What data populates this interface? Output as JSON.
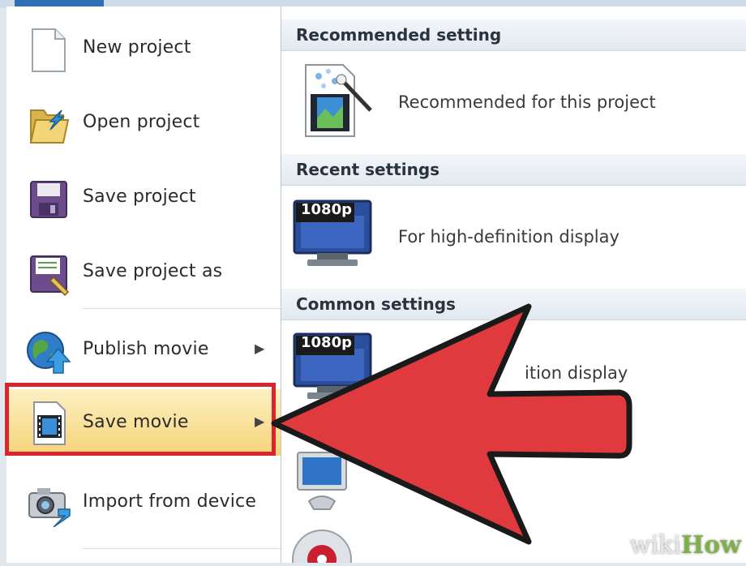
{
  "menu": {
    "items": [
      {
        "label": "New project"
      },
      {
        "label": "Open project"
      },
      {
        "label": "Save project"
      },
      {
        "label": "Save project as"
      },
      {
        "label": "Publish movie",
        "submenu": true
      },
      {
        "label": "Save movie",
        "submenu": true,
        "selected": true
      },
      {
        "label": "Import from device"
      }
    ]
  },
  "settings": {
    "recommended_header": "Recommended setting",
    "recommended_label": "Recommended for this project",
    "recent_header": "Recent settings",
    "recent_badge": "1080p",
    "recent_label": "For high-definition display",
    "common_header": "Common settings",
    "common_badge": "1080p",
    "common_label": "ition display"
  },
  "watermark": {
    "prefix": "wiki",
    "suffix": "How"
  },
  "colors": {
    "highlight_border": "#d7262d",
    "arrow": "#e03a3e",
    "selection": "#f6d479"
  }
}
